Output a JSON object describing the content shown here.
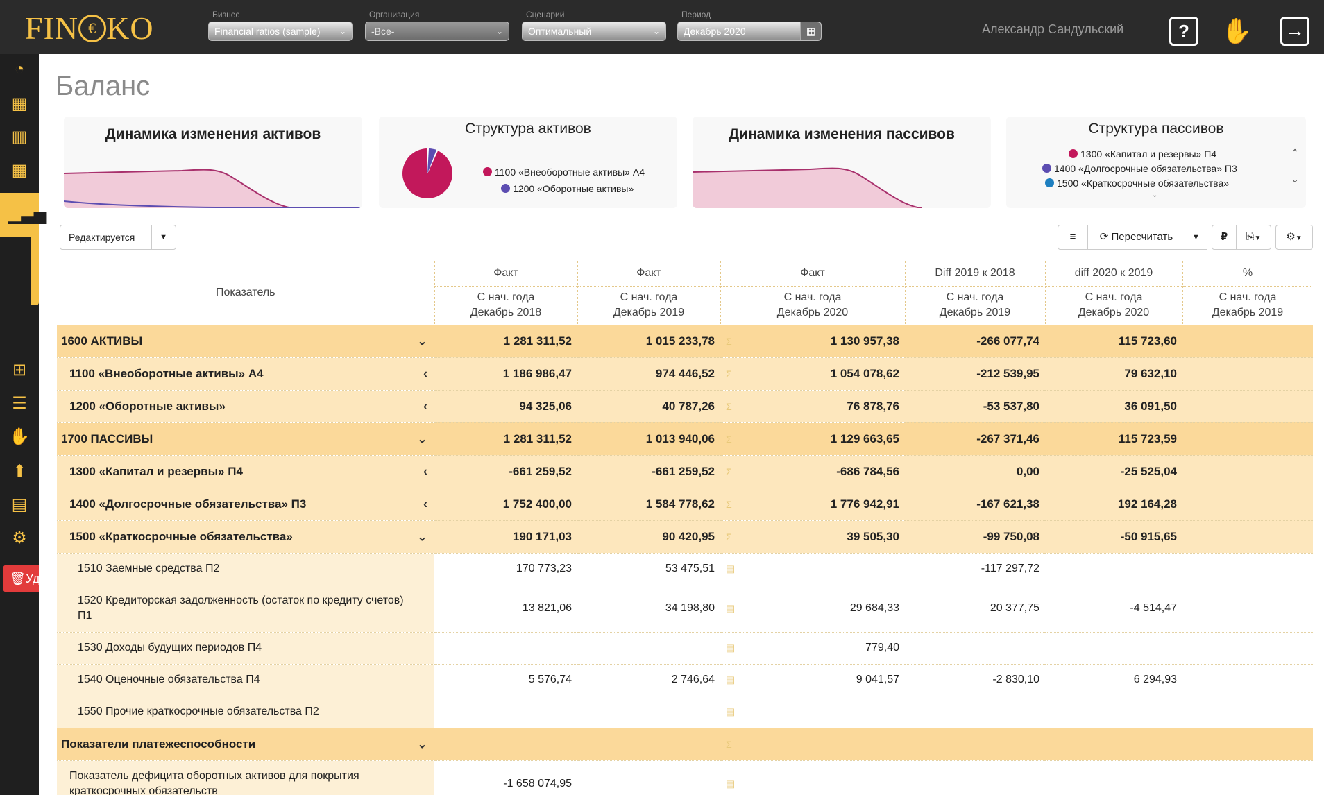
{
  "app": {
    "logo": "FIN€KO",
    "logo_left": "FIN",
    "logo_mid": "€",
    "logo_right": "KO"
  },
  "filters": {
    "business": {
      "label": "Бизнес",
      "value": "Financial ratios (sample)"
    },
    "organization": {
      "label": "Организация",
      "value": "-Все-"
    },
    "scenario": {
      "label": "Сценарий",
      "value": "Оптимальный"
    },
    "period": {
      "label": "Период",
      "value": "Декабрь 2020"
    }
  },
  "user": {
    "name": "Александр Сандульский"
  },
  "icons": {
    "help": "?",
    "user": "✋",
    "exit": "→",
    "calendar": "▦",
    "sidebar": [
      "dashboard-icon",
      "money-grid-icon",
      "building-icon",
      "money-grid-icon",
      "bar-chart-icon",
      "presentation-icon",
      "report-icon",
      "hand-coin-icon",
      "upload-icon",
      "table-icon",
      "gears-icon"
    ]
  },
  "sidebar": {
    "delete_label": "Уд"
  },
  "page": {
    "title": "Баланс"
  },
  "cards": {
    "assets_dynamics": {
      "title": "Динамика изменения активов"
    },
    "assets_structure": {
      "title": "Структура активов",
      "legend": [
        {
          "label": "1100 «Внеоборотные активы» А4",
          "color": "#c2185b"
        },
        {
          "label": "1200 «Оборотные активы»",
          "color": "#5c4db1"
        }
      ],
      "pie": [
        1054078.62,
        76878.76
      ]
    },
    "liabilities_dynamics": {
      "title": "Динамика изменения пассивов"
    },
    "liabilities_structure": {
      "title": "Структура пассивов",
      "legend": [
        {
          "label": "1300 «Капитал и резервы» П4",
          "color": "#c2185b"
        },
        {
          "label": "1400 «Долгосрочные обязательства» П3",
          "color": "#5c4db1"
        },
        {
          "label": "1500 «Краткосрочные обязательства»",
          "color": "#1e7fc0"
        }
      ]
    }
  },
  "toolbar": {
    "status": "Редактируется",
    "recalc_label": "Пересчитать",
    "currency_symbol": "₽",
    "filter_icon": "≡",
    "refresh_icon": "⟳",
    "excel_icon": "⎘",
    "gear_icon": "⚙"
  },
  "colors": {
    "accent": "#f5c146",
    "group_row": "#fbd99a",
    "subgroup_row": "#fde7bd",
    "leaf_label": "#fdf0d6",
    "chart_fill": "#f1cbd9",
    "chart_line": "#a8306c"
  },
  "table": {
    "indicator_header": "Показатель",
    "columns": [
      {
        "type": "Факт",
        "sub1": "С нач. года",
        "sub2": "Декабрь 2018"
      },
      {
        "type": "Факт",
        "sub1": "С нач. года",
        "sub2": "Декабрь 2019"
      },
      {
        "type": "Факт",
        "sub1": "С нач. года",
        "sub2": "Декабрь 2020"
      },
      {
        "type": "Diff 2019 к 2018",
        "sub1": "С нач. года",
        "sub2": "Декабрь 2019"
      },
      {
        "type": "diff 2020 к 2019",
        "sub1": "С нач. года",
        "sub2": "Декабрь 2020"
      },
      {
        "type": "%",
        "sub1": "С нач. года",
        "sub2": "Декабрь 2019"
      }
    ],
    "rows": [
      {
        "label": "1600 АКТИВЫ",
        "toggle": "⌄",
        "v": [
          "1 281 311,52",
          "1 015 233,78",
          "1 130 957,38",
          "-266 077,74",
          "115 723,60",
          ""
        ]
      },
      {
        "label": "1100 «Внеоборотные активы» А4",
        "toggle": "‹",
        "v": [
          "1 186 986,47",
          "974 446,52",
          "1 054 078,62",
          "-212 539,95",
          "79 632,10",
          ""
        ]
      },
      {
        "label": "1200 «Оборотные активы»",
        "toggle": "‹",
        "v": [
          "94 325,06",
          "40 787,26",
          "76 878,76",
          "-53 537,80",
          "36 091,50",
          ""
        ]
      },
      {
        "label": "1700 ПАССИВЫ",
        "toggle": "⌄",
        "v": [
          "1 281 311,52",
          "1 013 940,06",
          "1 129 663,65",
          "-267 371,46",
          "115 723,59",
          ""
        ]
      },
      {
        "label": "1300 «Капитал и резервы» П4",
        "toggle": "‹",
        "v": [
          "-661 259,52",
          "-661 259,52",
          "-686 784,56",
          "0,00",
          "-25 525,04",
          ""
        ]
      },
      {
        "label": "1400 «Долгосрочные обязательства» П3",
        "toggle": "‹",
        "v": [
          "1 752 400,00",
          "1 584 778,62",
          "1 776 942,91",
          "-167 621,38",
          "192 164,28",
          ""
        ]
      },
      {
        "label": "1500 «Краткосрочные обязательства»",
        "toggle": "⌄",
        "v": [
          "190 171,03",
          "90 420,95",
          "39 505,30",
          "-99 750,08",
          "-50 915,65",
          ""
        ]
      },
      {
        "label": "1510 Заемные средства П2",
        "v": [
          "170 773,23",
          "53 475,51",
          "",
          "-117 297,72",
          "",
          ""
        ]
      },
      {
        "label": "1520 Кредиторская задолженность (остаток по кредиту счетов) П1",
        "v": [
          "13 821,06",
          "34 198,80",
          "29 684,33",
          "20 377,75",
          "-4 514,47",
          ""
        ]
      },
      {
        "label": "1530 Доходы будущих периодов П4",
        "v": [
          "",
          "",
          "779,40",
          "",
          "",
          ""
        ]
      },
      {
        "label": "1540 Оценочные обязательства П4",
        "v": [
          "5 576,74",
          "2 746,64",
          "9 041,57",
          "-2 830,10",
          "6 294,93",
          ""
        ]
      },
      {
        "label": "1550 Прочие краткосрочные обязательства П2",
        "v": [
          "",
          "",
          "",
          "",
          "",
          ""
        ]
      },
      {
        "label": "Показатели платежеспособности",
        "toggle": "⌄",
        "v": [
          "",
          "",
          "",
          "",
          "",
          ""
        ]
      },
      {
        "label": "Показатель дефицита оборотных активов для покрытия краткосрочных обязательств",
        "v": [
          "-1 658 074,95",
          "",
          "",
          "",
          "",
          ""
        ]
      }
    ],
    "calc_glyph_sum": "Σ",
    "calc_glyph_calc": "▤"
  }
}
